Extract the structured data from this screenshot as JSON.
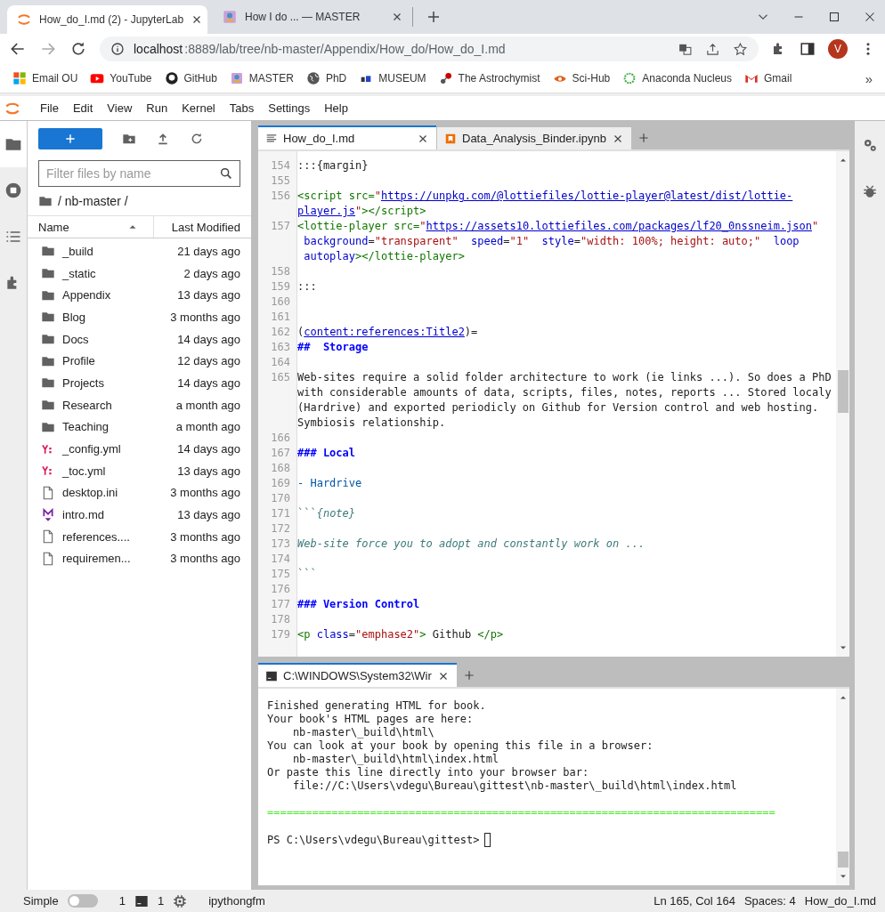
{
  "browser": {
    "tabs": [
      {
        "title": "How_do_I.md (2) - JupyterLab",
        "selected": true
      },
      {
        "title": "How I do ... — MASTER",
        "selected": false
      }
    ],
    "address": {
      "host": "localhost",
      "path": ":8889/lab/tree/nb-master/Appendix/How_do/How_do_I.md"
    },
    "profile_initial": "V",
    "bookmarks": [
      "Email OU",
      "YouTube",
      "GitHub",
      "MASTER",
      "PhD",
      "MUSEUM",
      "The Astrochymist",
      "Sci-Hub",
      "Anaconda Nucleus",
      "Gmail"
    ],
    "more_bookmarks": "»"
  },
  "menu": [
    "File",
    "Edit",
    "View",
    "Run",
    "Kernel",
    "Tabs",
    "Settings",
    "Help"
  ],
  "file_browser": {
    "filter": {
      "placeholder": "Filter files by name"
    },
    "breadcrumb": "/ nb-master /",
    "columns": [
      {
        "label": "Name",
        "sorted": true
      },
      {
        "label": "Last Modified",
        "sorted": false
      }
    ],
    "files": [
      {
        "name": "_build",
        "modified": "21 days ago",
        "kind": "folder"
      },
      {
        "name": "_static",
        "modified": "2 days ago",
        "kind": "folder"
      },
      {
        "name": "Appendix",
        "modified": "13 days ago",
        "kind": "folder"
      },
      {
        "name": "Blog",
        "modified": "3 months ago",
        "kind": "folder"
      },
      {
        "name": "Docs",
        "modified": "14 days ago",
        "kind": "folder"
      },
      {
        "name": "Profile",
        "modified": "12 days ago",
        "kind": "folder"
      },
      {
        "name": "Projects",
        "modified": "14 days ago",
        "kind": "folder"
      },
      {
        "name": "Research",
        "modified": "a month ago",
        "kind": "folder"
      },
      {
        "name": "Teaching",
        "modified": "a month ago",
        "kind": "folder"
      },
      {
        "name": "_config.yml",
        "modified": "14 days ago",
        "kind": "yaml"
      },
      {
        "name": "_toc.yml",
        "modified": "13 days ago",
        "kind": "yaml"
      },
      {
        "name": "desktop.ini",
        "modified": "3 months ago",
        "kind": "file"
      },
      {
        "name": "intro.md",
        "modified": "13 days ago",
        "kind": "markdown"
      },
      {
        "name": "references....",
        "modified": "3 months ago",
        "kind": "file"
      },
      {
        "name": "requiremen...",
        "modified": "3 months ago",
        "kind": "file"
      }
    ]
  },
  "editor": {
    "tabs": [
      {
        "label": "How_do_I.md",
        "kind": "markdown",
        "selected": true
      },
      {
        "label": "Data_Analysis_Binder.ipynb",
        "kind": "notebook",
        "selected": false
      }
    ],
    "lines": [
      {
        "num": "154",
        "rows": [
          {
            "segments": [
              {
                "kind": "p",
                "text": ":::{margin}"
              }
            ]
          }
        ]
      },
      {
        "num": "155"
      },
      {
        "num": "156",
        "rows": [
          {
            "segments": [
              {
                "kind": "t",
                "text": "<script src="
              },
              {
                "kind": "s",
                "text": "\""
              },
              {
                "kind": "u",
                "text": "https://unpkg.com/@lottiefiles/lottie-player@latest/dist/lottie-"
              }
            ]
          },
          {
            "segments": [
              {
                "kind": "u",
                "text": "player.js"
              },
              {
                "kind": "s",
                "text": "\""
              },
              {
                "kind": "t",
                "text": "></script>"
              }
            ]
          }
        ]
      },
      {
        "num": "157",
        "rows": [
          {
            "segments": [
              {
                "kind": "t",
                "text": "<lottie-player src="
              },
              {
                "kind": "s",
                "text": "\""
              },
              {
                "kind": "u",
                "text": "https://assets10.lottiefiles.com/packages/lf20_0nssneim.json"
              },
              {
                "kind": "s",
                "text": "\""
              }
            ]
          },
          {
            "segments": [
              {
                "kind": "a",
                "text": " background"
              },
              {
                "kind": "p",
                "text": "="
              },
              {
                "kind": "s",
                "text": "\"transparent\""
              },
              {
                "kind": "a",
                "text": "  speed"
              },
              {
                "kind": "p",
                "text": "="
              },
              {
                "kind": "s",
                "text": "\"1\""
              },
              {
                "kind": "a",
                "text": "  style"
              },
              {
                "kind": "p",
                "text": "="
              },
              {
                "kind": "s",
                "text": "\"width: 100%; height: auto;\""
              },
              {
                "kind": "a",
                "text": "  loop"
              }
            ]
          },
          {
            "segments": [
              {
                "kind": "a",
                "text": " autoplay"
              },
              {
                "kind": "t",
                "text": "></lottie-player>"
              }
            ]
          }
        ]
      },
      {
        "num": "158"
      },
      {
        "num": "159",
        "rows": [
          {
            "segments": [
              {
                "kind": "p",
                "text": ":::"
              }
            ]
          }
        ]
      },
      {
        "num": "160"
      },
      {
        "num": "161"
      },
      {
        "num": "162",
        "rows": [
          {
            "segments": [
              {
                "kind": "p",
                "text": "("
              },
              {
                "kind": "u",
                "text": "content:references:Title2"
              },
              {
                "kind": "p",
                "text": ")="
              }
            ]
          }
        ]
      },
      {
        "num": "163",
        "rows": [
          {
            "segments": [
              {
                "kind": "h",
                "text": "##  Storage"
              }
            ]
          }
        ]
      },
      {
        "num": "164"
      },
      {
        "num": "165",
        "rows": [
          {
            "segments": [
              {
                "kind": "p",
                "text": "Web-sites require a solid folder architecture to work (ie links ...). So does a PhD"
              }
            ]
          },
          {
            "segments": [
              {
                "kind": "p",
                "text": "with considerable amounts of data, scripts, files, notes, reports ... Stored localy"
              }
            ]
          },
          {
            "segments": [
              {
                "kind": "p",
                "text": "(Hardrive) and exported periodicly on Github for Version control and web hosting."
              }
            ]
          },
          {
            "segments": [
              {
                "kind": "p",
                "text": "Symbiosis relationship."
              }
            ]
          }
        ]
      },
      {
        "num": "166"
      },
      {
        "num": "167",
        "rows": [
          {
            "segments": [
              {
                "kind": "h",
                "text": "### Local"
              }
            ]
          }
        ]
      },
      {
        "num": "168"
      },
      {
        "num": "169",
        "rows": [
          {
            "segments": [
              {
                "kind": "l",
                "text": "- Hardrive"
              }
            ]
          }
        ]
      },
      {
        "num": "170"
      },
      {
        "num": "171",
        "rows": [
          {
            "segments": [
              {
                "kind": "q",
                "text": "```"
              },
              {
                "kind": "c",
                "text": "{note}"
              }
            ]
          }
        ]
      },
      {
        "num": "172"
      },
      {
        "num": "173",
        "rows": [
          {
            "segments": [
              {
                "kind": "c",
                "text": "Web-site force you to adopt and constantly work on ..."
              }
            ]
          }
        ]
      },
      {
        "num": "174"
      },
      {
        "num": "175",
        "rows": [
          {
            "segments": [
              {
                "kind": "q",
                "text": "```"
              }
            ]
          }
        ]
      },
      {
        "num": "176"
      },
      {
        "num": "177",
        "rows": [
          {
            "segments": [
              {
                "kind": "h",
                "text": "### Version Control"
              }
            ]
          }
        ]
      },
      {
        "num": "178"
      },
      {
        "num": "179",
        "rows": [
          {
            "segments": [
              {
                "kind": "t",
                "text": "<p "
              },
              {
                "kind": "a",
                "text": "class"
              },
              {
                "kind": "p",
                "text": "="
              },
              {
                "kind": "s",
                "text": "\"emphase2\""
              },
              {
                "kind": "t",
                "text": ">"
              },
              {
                "kind": "p",
                "text": " Github "
              },
              {
                "kind": "t",
                "text": "</p>"
              }
            ]
          }
        ]
      }
    ]
  },
  "terminal": {
    "tabs": [
      {
        "label": "C:\\WINDOWS\\System32\\Wir",
        "selected": true
      }
    ],
    "lines": [
      {
        "kind": "out",
        "text": "Finished generating HTML for book."
      },
      {
        "kind": "out",
        "text": "Your book's HTML pages are here:"
      },
      {
        "kind": "out",
        "text": "    nb-master\\_build\\html\\"
      },
      {
        "kind": "out",
        "text": "You can look at your book by opening this file in a browser:"
      },
      {
        "kind": "out",
        "text": "    nb-master\\_build\\html\\index.html"
      },
      {
        "kind": "out",
        "text": "Or paste this line directly into your browser bar:"
      },
      {
        "kind": "out",
        "text": "    file://C:\\Users\\vdegu\\Bureau\\gittest\\nb-master\\_build\\html\\index.html"
      },
      {
        "kind": "rule",
        "text": "==============================================================================="
      }
    ],
    "prompt": "PS C:\\Users\\vdegu\\Bureau\\gittest>"
  },
  "status_bar": {
    "mode_label": "Simple",
    "simple_mode": false,
    "kernels": "1",
    "terminals": "1",
    "kernel_name": "ipythongfm",
    "cursor": "Ln 165, Col 164",
    "spaces": "Spaces: 4",
    "file": "How_do_I.md"
  }
}
